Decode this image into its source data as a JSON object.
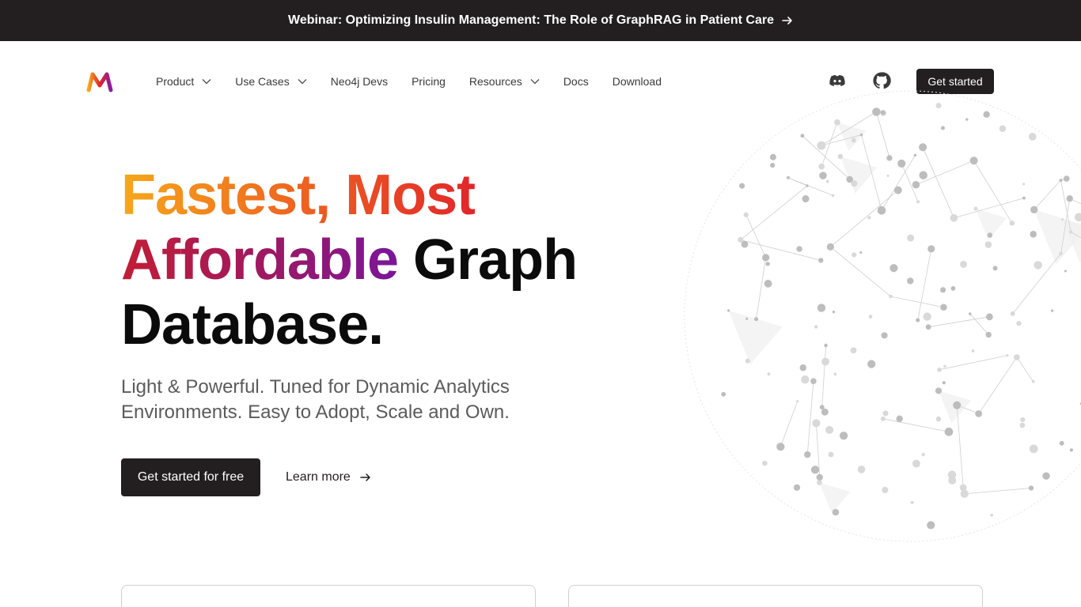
{
  "banner": {
    "text": "Webinar: Optimizing Insulin Management: The Role of GraphRAG in Patient Care",
    "arrow_icon": "arrow-right-icon"
  },
  "nav": {
    "logo_icon": "memgraph-logo-icon",
    "items": [
      {
        "label": "Product",
        "has_dropdown": true
      },
      {
        "label": "Use Cases",
        "has_dropdown": true
      },
      {
        "label": "Neo4j Devs",
        "has_dropdown": false
      },
      {
        "label": "Pricing",
        "has_dropdown": false
      },
      {
        "label": "Resources",
        "has_dropdown": true
      },
      {
        "label": "Docs",
        "has_dropdown": false
      },
      {
        "label": "Download",
        "has_dropdown": false
      }
    ],
    "icons": [
      "discord-icon",
      "github-icon"
    ],
    "cta_label": "Get started"
  },
  "hero": {
    "title_part1": "Fastest, Most",
    "title_part2": "Affordable",
    "title_part3": "Graph",
    "title_part4": "Database.",
    "subtitle": "Light & Powerful. Tuned for Dynamic Analytics Environments. Easy to Adopt, Scale and Own.",
    "primary_cta": "Get started for free",
    "secondary_cta": "Learn more"
  },
  "colors": {
    "dark": "#231f20",
    "gradient_start": "#f6a81a",
    "gradient_mid": "#e2262a",
    "gradient_end": "#7a169a"
  }
}
